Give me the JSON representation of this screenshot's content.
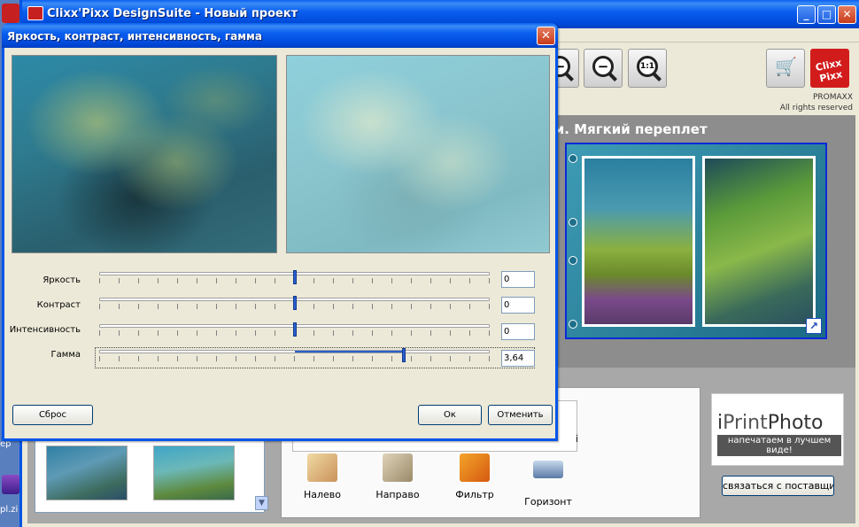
{
  "desktop": {
    "labels": [
      "ep",
      "pl.zi"
    ]
  },
  "main_window": {
    "title": "Clixx'Pixx DesignSuite - Новый проект",
    "icons": {
      "minimize": "_",
      "maximize": "□",
      "close": "✕"
    }
  },
  "toolbar": {
    "zoom_in_glyph": "−",
    "zoom_out_glyph": "−",
    "zoom_actual_glyph": "1:1",
    "cart_glyph": "🛒",
    "logo_text": "Clixx Pixx",
    "brand_name": "PROMAXX",
    "brand_rights": "All rights reserved"
  },
  "workspace": {
    "product_title": "м. Мягкий переплет",
    "corner_glyph": "↗"
  },
  "lower": {
    "filter_frame_fragment": "і",
    "tools": [
      {
        "label": "Налево"
      },
      {
        "label": "Направо"
      },
      {
        "label": "Фильтр"
      },
      {
        "label": "Горизонт"
      }
    ],
    "ad": {
      "logo_i": "i",
      "logo_print": "Print",
      "logo_photo": "Photo",
      "slogan": "напечатаем в лучшем виде!"
    },
    "contact_button": "связаться с поставщиком",
    "scroll_down_glyph": "▼"
  },
  "dialog": {
    "title": "Яркость, контраст, интенсивность, гамма",
    "close_glyph": "✕",
    "sliders": [
      {
        "label": "Яркость",
        "value": "0",
        "position": 0.5
      },
      {
        "label": "Контраст",
        "value": "0",
        "position": 0.5
      },
      {
        "label": "Интенсивность",
        "value": "0",
        "position": 0.5
      },
      {
        "label": "Гамма",
        "value": "3,64",
        "position": 0.78
      }
    ],
    "buttons": {
      "reset": "Сброс",
      "ok": "Ок",
      "cancel": "Отменить"
    }
  },
  "colors": {
    "titlebar_blue": "#0a5ff0",
    "close_red": "#c73c1c",
    "slider_thumb": "#2a5fcf",
    "brand_red": "#d21c1c"
  }
}
